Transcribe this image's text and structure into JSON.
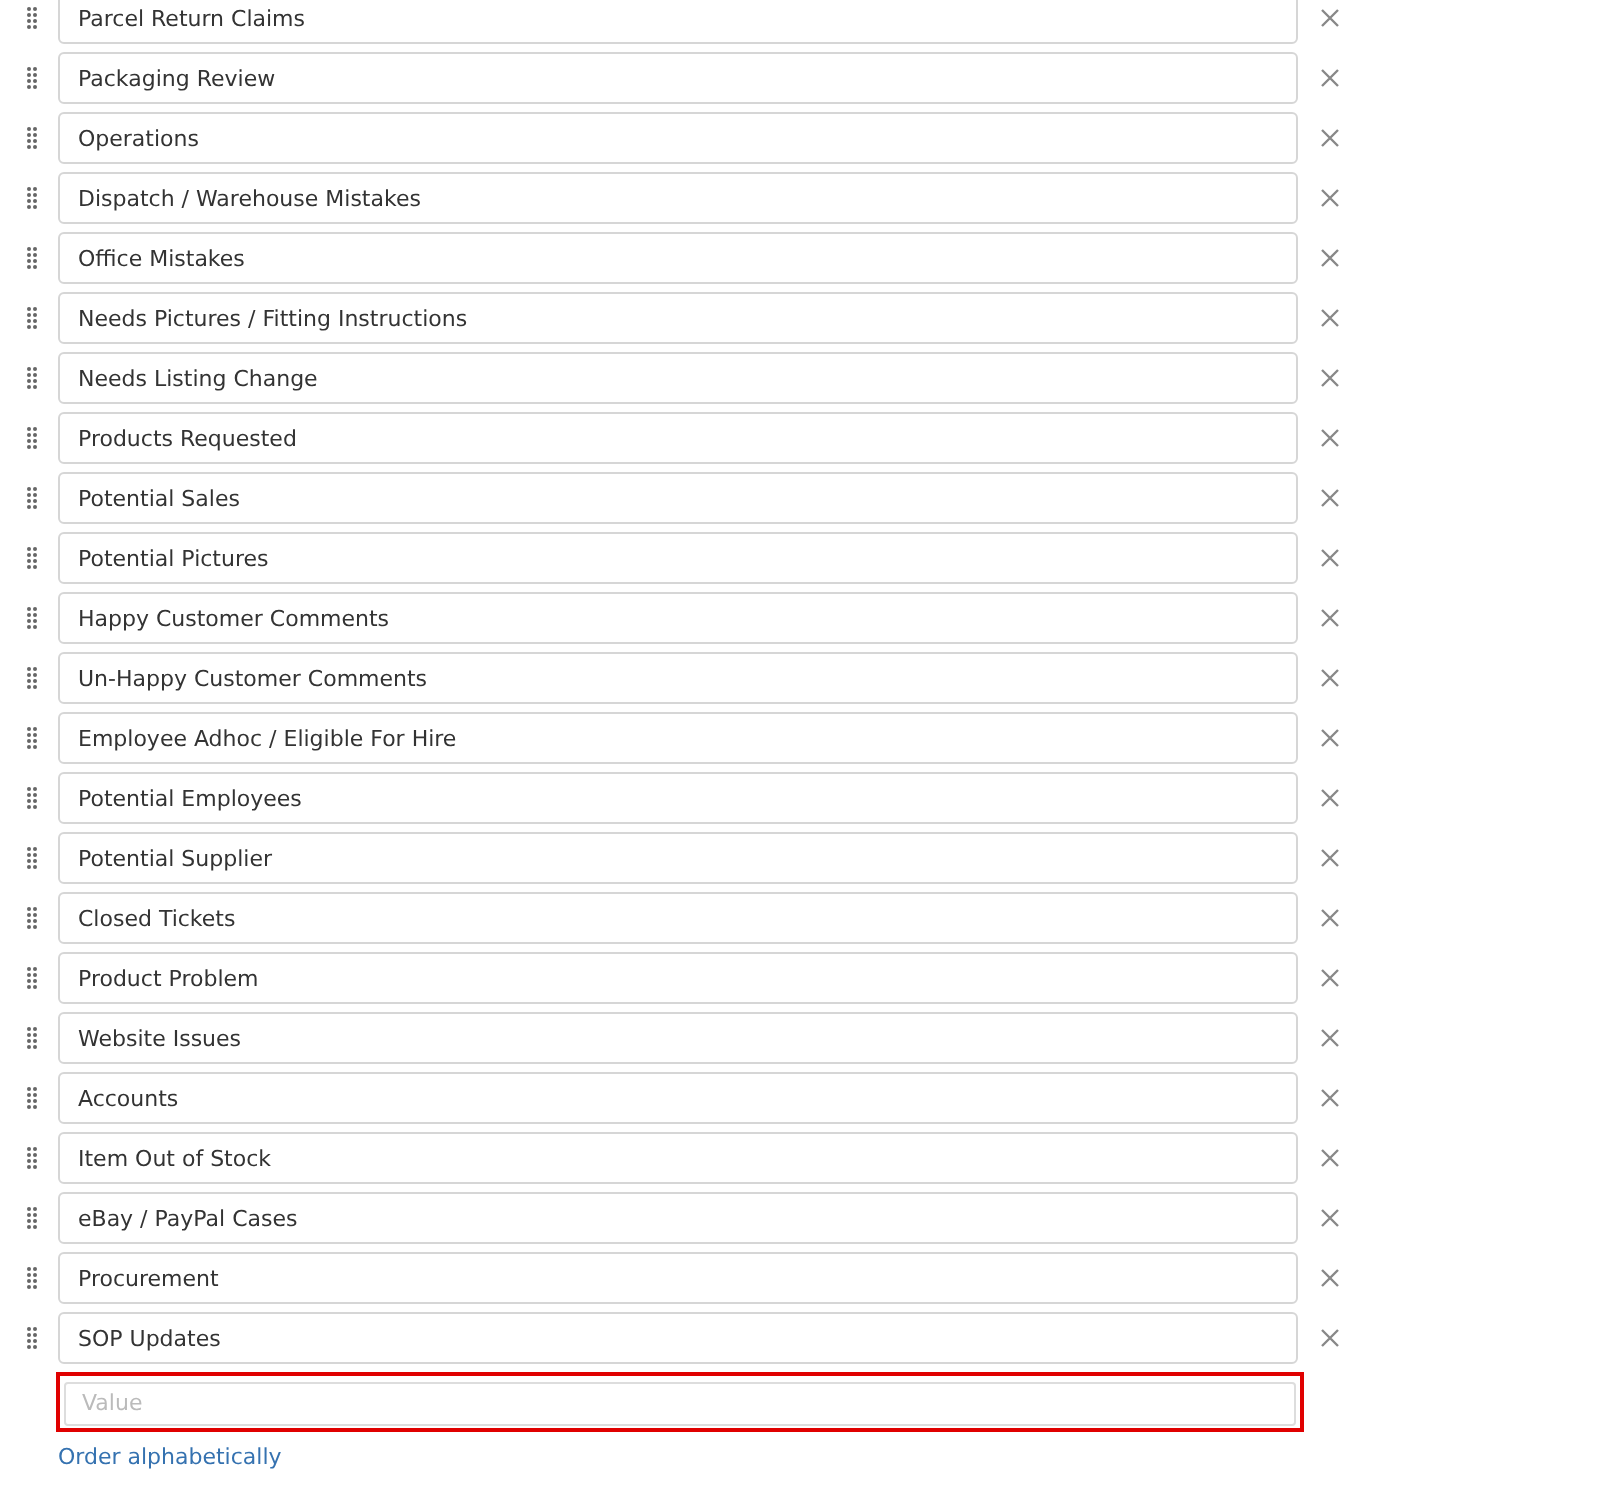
{
  "options": [
    {
      "value": "Parcel Return Claims"
    },
    {
      "value": "Packaging Review"
    },
    {
      "value": "Operations"
    },
    {
      "value": "Dispatch / Warehouse Mistakes"
    },
    {
      "value": "Office Mistakes"
    },
    {
      "value": "Needs Pictures / Fitting Instructions"
    },
    {
      "value": "Needs Listing Change"
    },
    {
      "value": "Products Requested"
    },
    {
      "value": "Potential Sales"
    },
    {
      "value": "Potential Pictures"
    },
    {
      "value": "Happy Customer Comments"
    },
    {
      "value": "Un-Happy Customer Comments"
    },
    {
      "value": "Employee Adhoc / Eligible For Hire"
    },
    {
      "value": "Potential Employees"
    },
    {
      "value": "Potential Supplier"
    },
    {
      "value": "Closed Tickets"
    },
    {
      "value": "Product Problem"
    },
    {
      "value": "Website Issues"
    },
    {
      "value": "Accounts"
    },
    {
      "value": "Item Out of Stock"
    },
    {
      "value": "eBay / PayPal Cases"
    },
    {
      "value": "Procurement"
    },
    {
      "value": "SOP Updates"
    }
  ],
  "new_value": {
    "placeholder": "Value",
    "highlighted": true
  },
  "order_link": "Order alphabetically"
}
